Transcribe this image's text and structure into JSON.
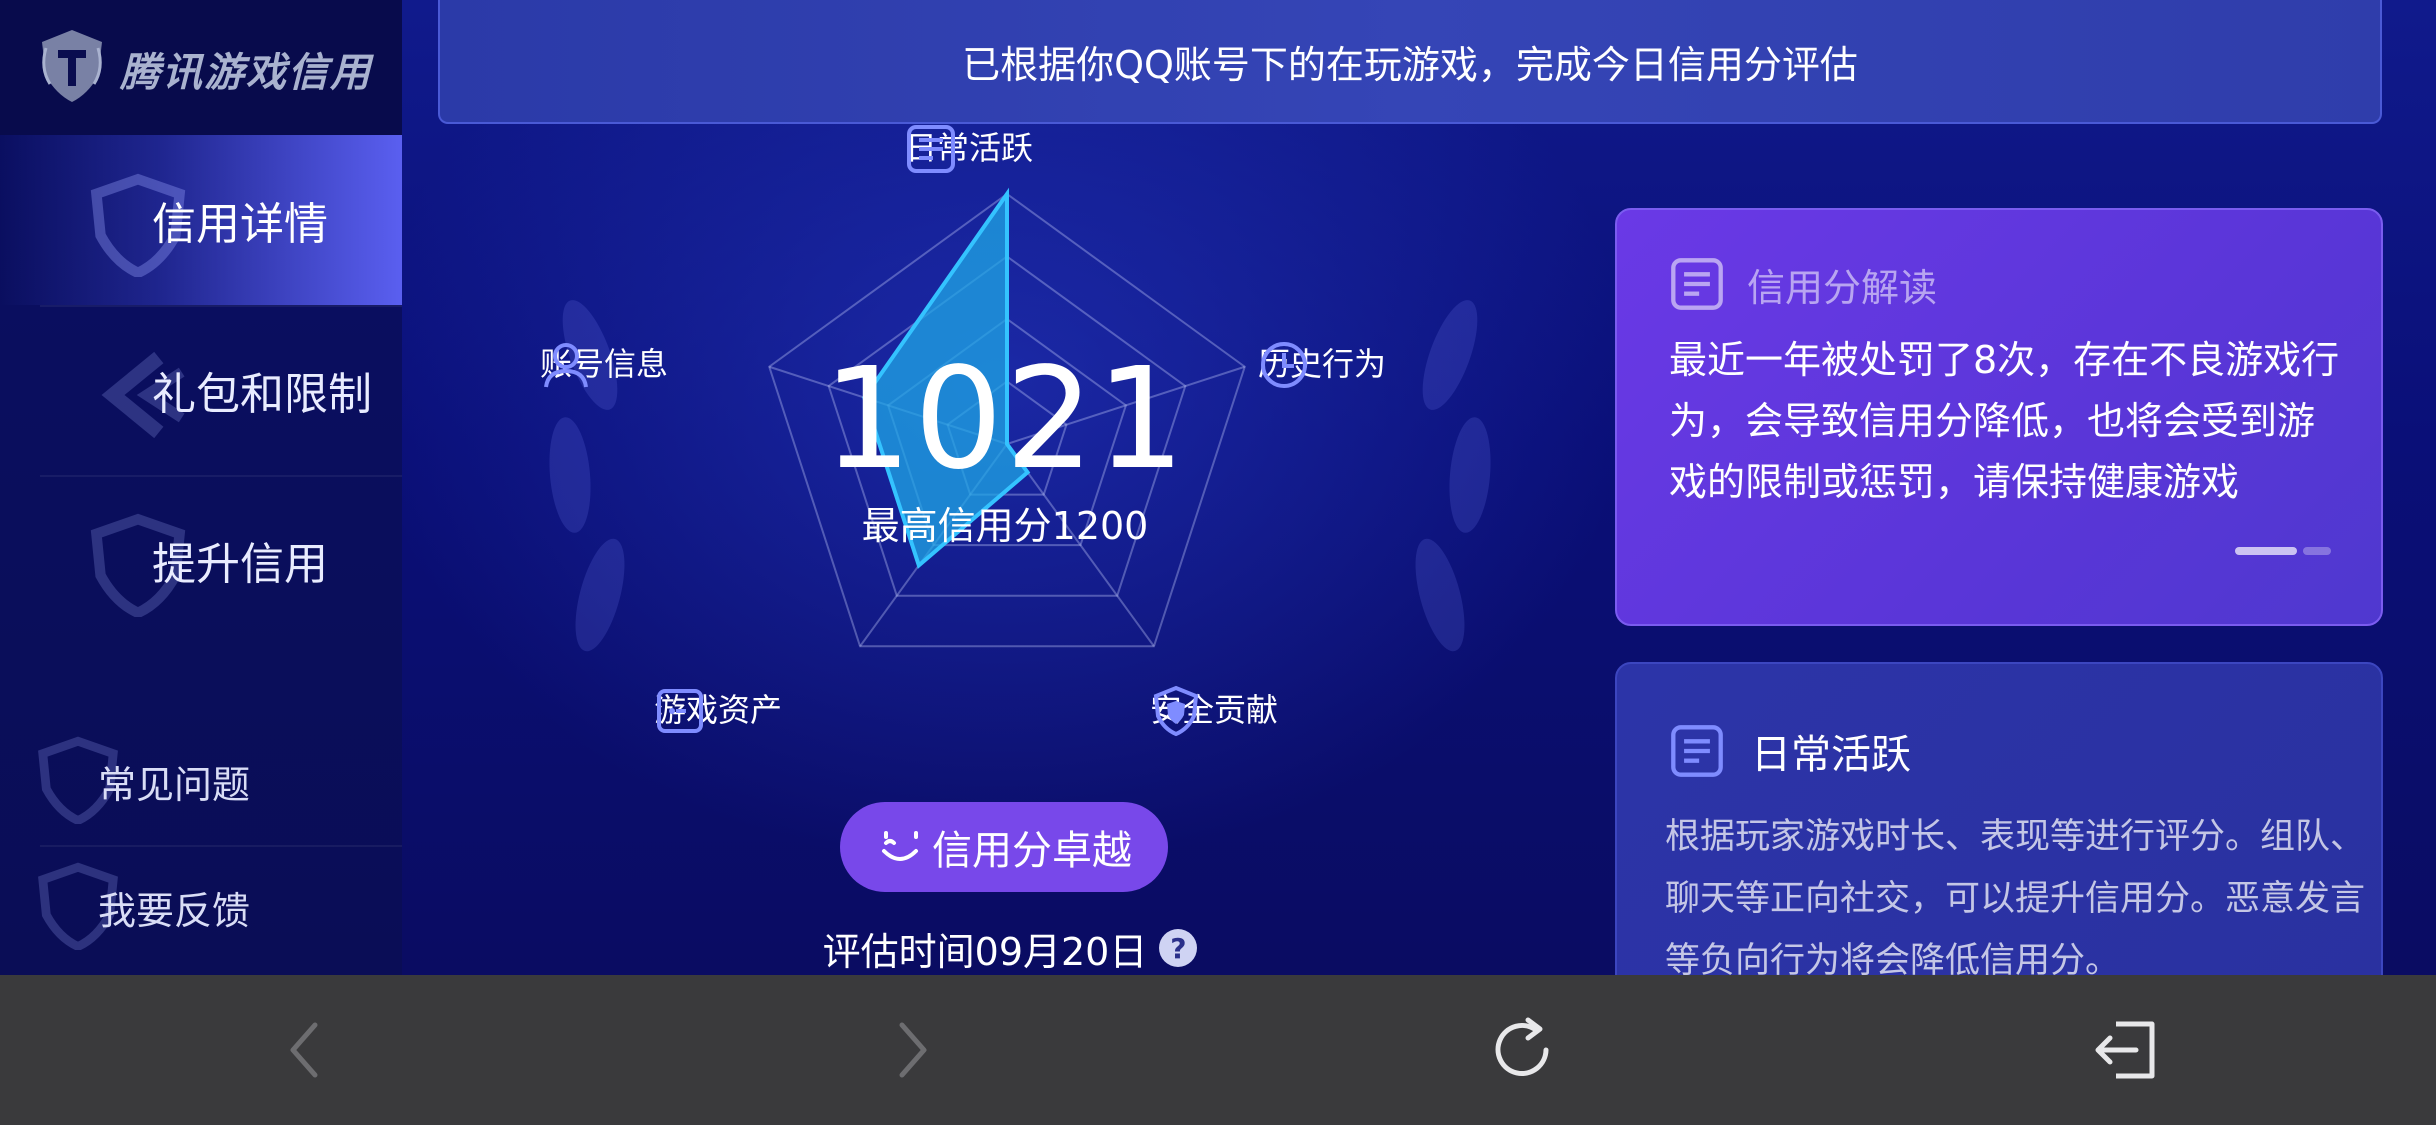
{
  "brand": {
    "name": "腾讯游戏信用"
  },
  "sidebar": {
    "items": [
      {
        "label": "信用详情",
        "active": true
      },
      {
        "label": "礼包和限制",
        "active": false
      },
      {
        "label": "提升信用",
        "active": false
      }
    ],
    "links": [
      {
        "label": "常见问题"
      },
      {
        "label": "我要反馈"
      }
    ]
  },
  "banner": {
    "text": "已根据你QQ账号下的在玩游戏，完成今日信用分评估"
  },
  "radar": {
    "axes": [
      "日常活跃",
      "历史行为",
      "安全贡献",
      "游戏资产",
      "账号信息"
    ],
    "levels": [
      1.0,
      0.0,
      0.14,
      0.6,
      0.6
    ],
    "fill_color": "#1fa7e6"
  },
  "score": {
    "value": "1021",
    "max_label": "最高信用分1200",
    "grade": "信用分卓越",
    "eval_time": "评估时间09月20日",
    "help_icon": "?"
  },
  "cards": {
    "interpret": {
      "title": "信用分解读",
      "body": "最近一年被处罚了8次，存在不良游戏行为，会导致信用分降低，也将会受到游戏的限制或惩罚，请保持健康游戏"
    },
    "daily": {
      "title": "日常活跃",
      "body": "根据玩家游戏时长、表现等进行评分。组队、聊天等正向社交，可以提升信用分。恶意发言等负向行为将会降低信用分。"
    }
  },
  "colors": {
    "accent": "#7848ea",
    "radar_fill": "#1fa7e6",
    "card_purple": "#6a39e6",
    "toolbar": "#3a3a3c"
  },
  "toolbar": {
    "icons": [
      "back-arrow-icon",
      "forward-arrow-icon",
      "refresh-icon",
      "exit-icon"
    ]
  }
}
